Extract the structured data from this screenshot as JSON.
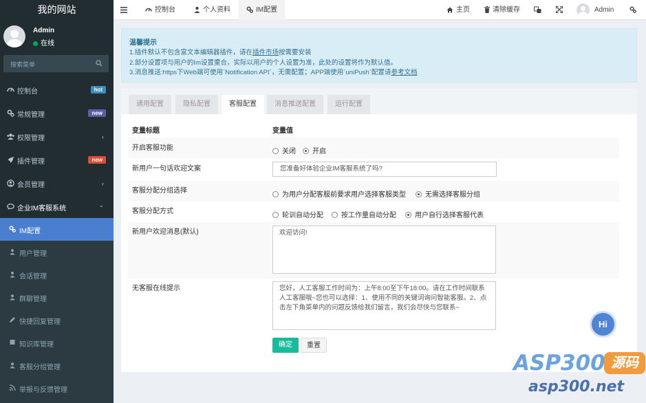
{
  "app": {
    "title": "我的网站"
  },
  "user": {
    "name": "Admin",
    "status": "在线"
  },
  "search": {
    "placeholder": "搜索菜单"
  },
  "sidebar": {
    "items": [
      {
        "label": "控制台",
        "icon": "dashboard-icon",
        "badge": "hot",
        "badge_color": "#3c8dbc"
      },
      {
        "label": "常规管理",
        "icon": "cogs-icon",
        "badge": "new",
        "badge_color": "#605ca8"
      },
      {
        "label": "权限管理",
        "icon": "group-icon",
        "chevron": "‹"
      },
      {
        "label": "插件管理",
        "icon": "rocket-icon",
        "badge": "new",
        "badge_color": "#dd4b39"
      },
      {
        "label": "会员管理",
        "icon": "user-circle-icon",
        "chevron": "‹"
      },
      {
        "label": "企业IM客服系统",
        "icon": "comments-icon",
        "chevron": "⌄"
      }
    ],
    "subitems": [
      {
        "label": "IM配置",
        "icon": "cogs-icon"
      },
      {
        "label": "用户管理",
        "icon": "group-icon"
      },
      {
        "label": "会话管理",
        "icon": "user-icon"
      },
      {
        "label": "群聊管理",
        "icon": "group-icon"
      },
      {
        "label": "快捷回复管理",
        "icon": "pencil-icon"
      },
      {
        "label": "知识库管理",
        "icon": "book-icon"
      },
      {
        "label": "客服分组管理",
        "icon": "group-icon"
      },
      {
        "label": "举报与反馈管理",
        "icon": "rss-icon"
      }
    ]
  },
  "header": {
    "tabs": [
      {
        "label": "控制台",
        "icon": "dashboard-icon"
      },
      {
        "label": "个人资料",
        "icon": "user-icon"
      },
      {
        "label": "IM配置",
        "icon": "cogs-icon"
      }
    ],
    "home": "主页",
    "clear_cache": "清除缓存",
    "user": "Admin"
  },
  "alert": {
    "title": "温馨提示",
    "line1_pre": "1.插件默认不包含富文本编辑器插件，请在",
    "line1_link": "插件市场",
    "line1_post": "按需要安装",
    "line2": "2.部分设置项与用户的Im设置重合，实际以用户的个人设置为准，此处的设置将作为默认值。",
    "line3_pre": "3.消息推送:https下Web端可使用`Notification API`，无需配置；APP端使用`uniPush`配置请",
    "line3_link": "参考文档"
  },
  "tabs": [
    "通用配置",
    "隐私配置",
    "客服配置",
    "消息推送配置",
    "运行配置"
  ],
  "form": {
    "col_title": "变量标题",
    "col_value": "变量值",
    "rows": {
      "enable": {
        "label": "开启客服功能",
        "options": [
          "关闭",
          "开启"
        ]
      },
      "welcome": {
        "label": "新用户一句话欢迎文案",
        "value": "您准备好体验企业IM客服系统了吗?"
      },
      "group_select": {
        "label": "客服分配分组选择",
        "options": [
          "为用户分配客服前要求用户选择客服类型",
          "无需选择客服分组"
        ]
      },
      "assign_mode": {
        "label": "客服分配方式",
        "options": [
          "轮训自动分配",
          "按工作量自动分配",
          "用户自行选择客服代表"
        ]
      },
      "welcome_msg": {
        "label": "新用户欢迎消息(默认)",
        "value": "欢迎访问!"
      },
      "offline": {
        "label": "无客服在线提示",
        "value": "您好，人工客服工作时间为：上午8:00至下午18:00。请在工作时间联系人工客服哦~您也可以选择：1、使用不同的关键词询问智能客服。2、点击左下角菜单内的问题反馈给我们留言，我们会尽快与您联系~"
      }
    },
    "submit": "确定",
    "reset": "重置"
  },
  "chat": {
    "label": "Hi"
  },
  "watermark": {
    "line1": "ASP300",
    "tag": "源码",
    "line2": "asp300.net"
  }
}
